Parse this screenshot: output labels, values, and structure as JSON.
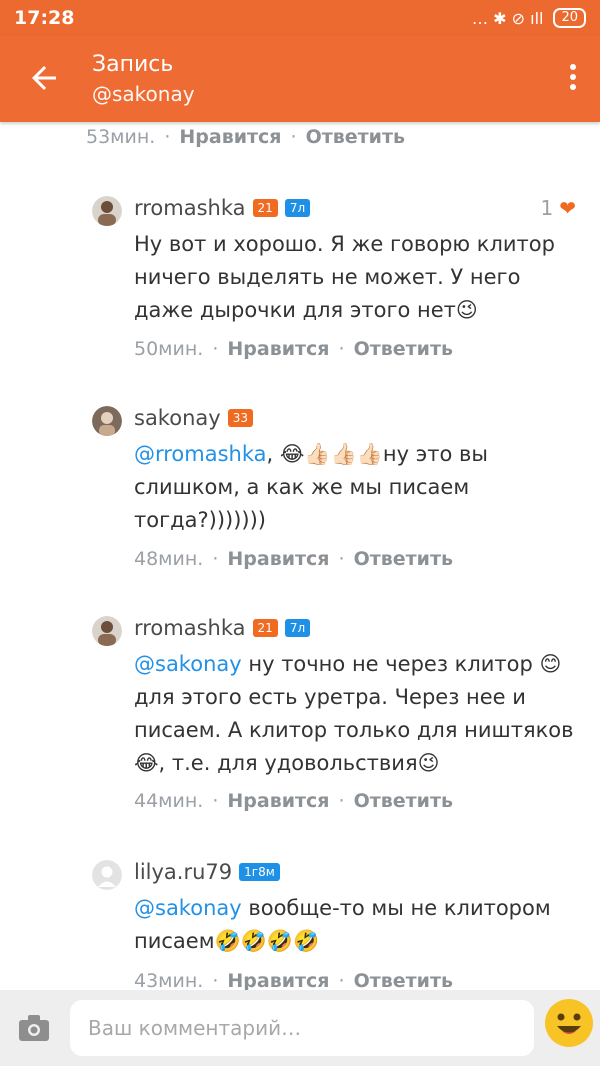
{
  "status": {
    "time": "17:28",
    "icons": "… ✱ ⊘ ıll",
    "battery": "20"
  },
  "header": {
    "title": "Запись",
    "subtitle": "@sakonay"
  },
  "colors": {
    "accent": "#ee6b33",
    "mention": "#2391e6",
    "badge_blue": "#1e90e6"
  },
  "top_meta": {
    "time": "53мин.",
    "like": "Нравится",
    "reply": "Ответить"
  },
  "comments": [
    {
      "author": "rromashka",
      "badge1": "21",
      "badge2": "7л",
      "likes": "1",
      "text": "Ну вот и хорошо. Я же говорю клитор ничего выделять не может. У него даже дырочки для этого нет😉",
      "time": "50мин.",
      "like": "Нравится",
      "reply": "Ответить"
    },
    {
      "author": "sakonay",
      "badge1": "33",
      "mention": "@rromashka",
      "text": ", 😂👍🏻👍🏻👍🏻ну это вы слишком, а как же мы писаем тогда?)))))))",
      "time": "48мин.",
      "like": "Нравится",
      "reply": "Ответить"
    },
    {
      "author": "rromashka",
      "badge1": "21",
      "badge2": "7л",
      "mention": "@sakonay",
      "text": " ну точно не через клитор 😊 для этого есть уретра. Через нее и писаем. А клитор только для ништяков 😂, т.е. для удовольствия😉",
      "time": "44мин.",
      "like": "Нравится",
      "reply": "Ответить"
    },
    {
      "author": "lilya.ru79",
      "badge2": "1г8м",
      "mention": "@sakonay",
      "text": " вообще-то мы не клитором писаем🤣🤣🤣🤣",
      "time": "43мин.",
      "like": "Нравится",
      "reply": "Ответить"
    }
  ],
  "composer": {
    "placeholder": "Ваш комментарий…"
  }
}
